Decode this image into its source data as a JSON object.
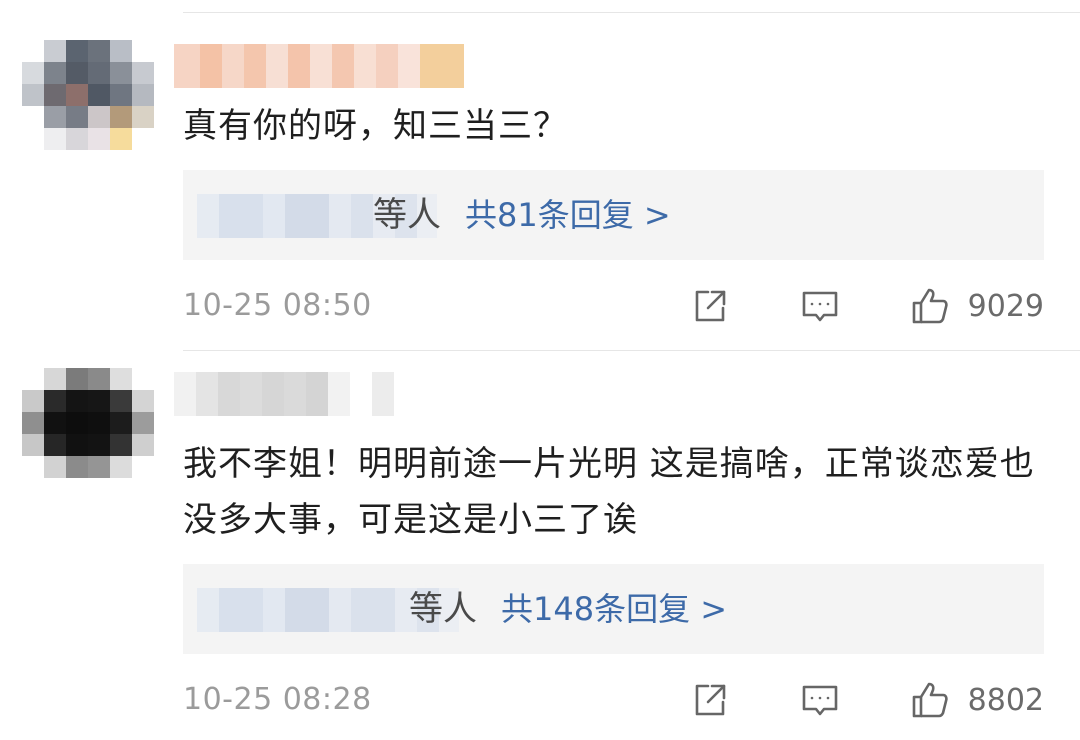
{
  "comments": [
    {
      "username": "",
      "text": "真有你的呀，知三当三？",
      "reply_prefix": "等人",
      "reply_link": "共81条回复 >",
      "time": "10-25 08:50",
      "likes": "9029",
      "icons": [
        "share-icon",
        "comment-icon",
        "thumbs-up-icon"
      ]
    },
    {
      "username": "",
      "text": "我不李姐！明明前途一片光明 这是搞啥，正常谈恋爱也没多大事，可是这是小三了诶",
      "reply_prefix": "等人",
      "reply_link": "共148条回复 >",
      "time": "10-25 08:28",
      "likes": "8802",
      "icons": [
        "share-icon",
        "comment-icon",
        "thumbs-up-icon"
      ]
    }
  ],
  "colors": {
    "reply_link": "#3d6aa8",
    "reply_box_bg": "#f4f4f4",
    "meta_text": "#9b9b9b"
  }
}
